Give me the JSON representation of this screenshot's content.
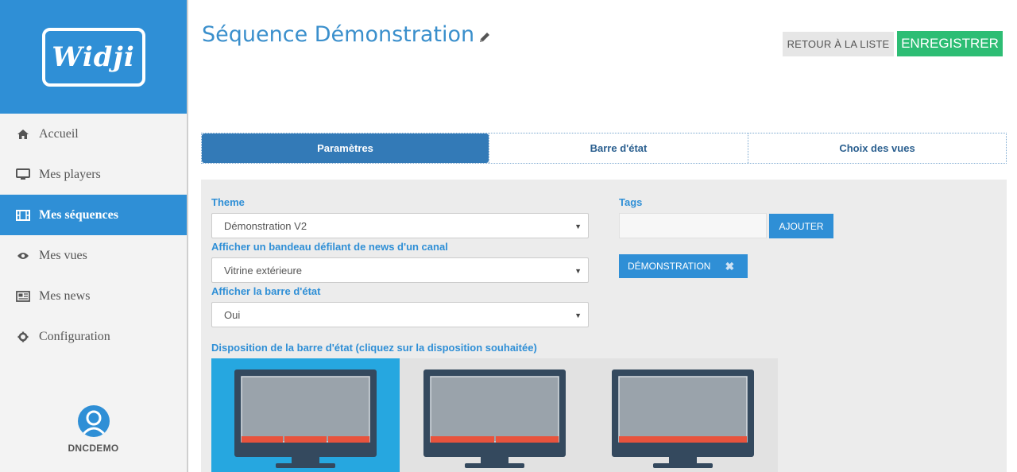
{
  "sidebar": {
    "logo": "Widji",
    "items": [
      {
        "label": "Accueil",
        "icon": "home-icon",
        "active": false
      },
      {
        "label": "Mes players",
        "icon": "monitor-icon",
        "active": false
      },
      {
        "label": "Mes séquences",
        "icon": "film-icon",
        "active": true
      },
      {
        "label": "Mes vues",
        "icon": "eye-icon",
        "active": false
      },
      {
        "label": "Mes news",
        "icon": "newspaper-icon",
        "active": false
      },
      {
        "label": "Configuration",
        "icon": "gear-icon",
        "active": false
      }
    ],
    "user": {
      "name": "DNCDEMO",
      "icon": "user-avatar-icon"
    }
  },
  "header": {
    "title": "Séquence Démonstration",
    "back_label": "RETOUR À LA LISTE",
    "save_label": "ENREGISTRER"
  },
  "tabs": [
    {
      "label": "Paramètres",
      "active": true
    },
    {
      "label": "Barre d'état",
      "active": false
    },
    {
      "label": "Choix des vues",
      "active": false
    }
  ],
  "form": {
    "theme": {
      "label": "Theme",
      "value": "Démonstration V2"
    },
    "news": {
      "label": "Afficher un bandeau défilant de news d'un canal",
      "value": "Vitrine extérieure"
    },
    "statusbar": {
      "label": "Afficher la barre d'état",
      "value": "Oui"
    },
    "layout_label": "Disposition de la barre d'état (cliquez sur la disposition souhaitée)",
    "tags": {
      "label": "Tags",
      "input_value": "",
      "add_label": "AJOUTER",
      "items": [
        "DÉMONSTRATION"
      ]
    }
  },
  "layouts": [
    {
      "segments": 3,
      "selected": true
    },
    {
      "segments": 2,
      "selected": false
    },
    {
      "segments": 1,
      "selected": false
    }
  ],
  "colors": {
    "primary": "#2f8fd6",
    "save_green": "#2dbd74",
    "layout_selected": "#26a7e0",
    "statusbar_red": "#e8533d"
  }
}
